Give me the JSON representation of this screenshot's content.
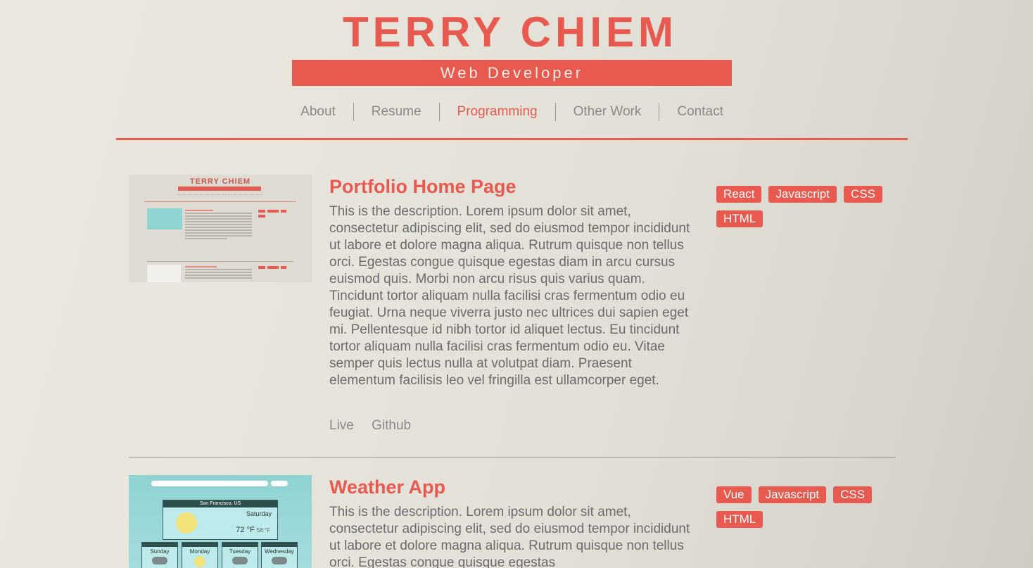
{
  "header": {
    "title": "TERRY CHIEM",
    "subtitle": "Web Developer"
  },
  "nav": {
    "items": [
      "About",
      "Resume",
      "Programming",
      "Other Work",
      "Contact"
    ],
    "active": "Programming"
  },
  "projects": [
    {
      "title": "Portfolio Home Page",
      "description": "This is the description. Lorem ipsum dolor sit amet, consectetur adipiscing elit, sed do eiusmod tempor incididunt ut labore et dolore magna aliqua. Rutrum quisque non tellus orci. Egestas congue quisque egestas diam in arcu cursus euismod quis. Morbi non arcu risus quis varius quam. Tincidunt tortor aliquam nulla facilisi cras fermentum odio eu feugiat. Urna neque viverra justo nec ultrices dui sapien eget mi. Pellentesque id nibh tortor id aliquet lectus. Eu tincidunt tortor aliquam nulla facilisi cras fermentum odio eu. Vitae semper quis lectus nulla at volutpat diam. Praesent elementum facilisis leo vel fringilla est ullamcorper eget.",
      "links": [
        "Live",
        "Github"
      ],
      "tags": [
        "React",
        "Javascript",
        "CSS",
        "HTML"
      ],
      "thumbnail": {
        "title": "TERRY CHIEM",
        "subtitle": "Web Developer",
        "item1": "Weather App",
        "item2": "Project Task Tracker"
      }
    },
    {
      "title": "Weather App",
      "description": "This is the description. Lorem ipsum dolor sit amet, consectetur adipiscing elit, sed do eiusmod tempor incididunt ut labore et dolore magna aliqua. Rutrum quisque non tellus orci. Egestas congue quisque egestas",
      "tags": [
        "Vue",
        "Javascript",
        "CSS",
        "HTML"
      ],
      "thumbnail": {
        "city": "San Francisco, US",
        "day": "Saturday",
        "temp": "72 °F",
        "low": "58 °F",
        "days": [
          "Sunday",
          "Monday",
          "Tuesday",
          "Wednesday"
        ]
      }
    }
  ],
  "colors": {
    "accent": "#e85a4f",
    "text": "#6b6b6b",
    "muted": "#8a8a8a",
    "weather_bg": "#8fd3d3"
  }
}
